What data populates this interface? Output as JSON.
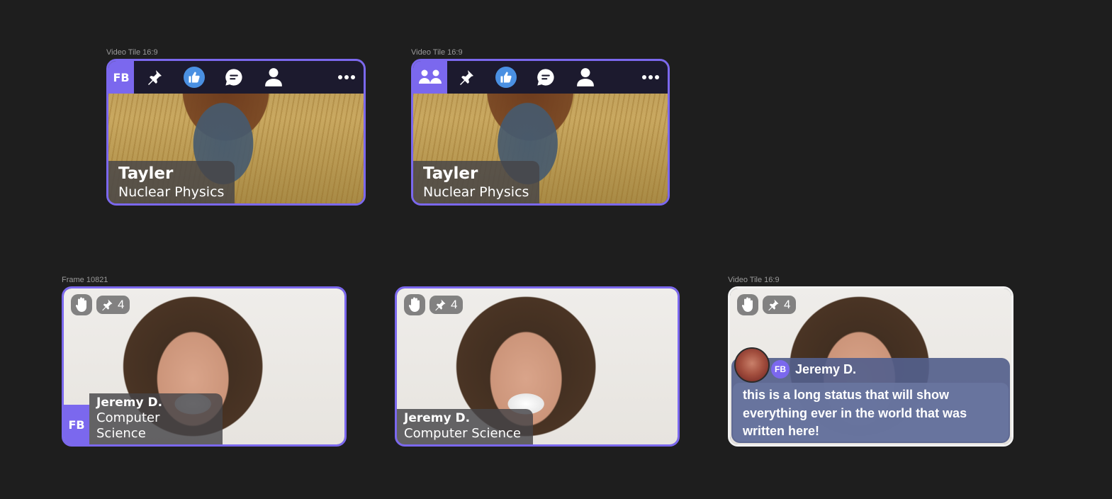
{
  "frames": {
    "top_left": "Video Tile 16:9",
    "top_right": "Video Tile 16:9",
    "bottom_left": "Frame 10821",
    "bottom_right": "Video Tile 16:9"
  },
  "toolbar_tiles": [
    {
      "badge_text": "FB",
      "icons": [
        "pin-icon",
        "thumbs-up-icon",
        "chat-icon",
        "person-icon",
        "more-icon"
      ],
      "participant": {
        "name": "Tayler",
        "subtitle": "Nuclear Physics"
      }
    },
    {
      "badge_icon": "group-icon",
      "icons": [
        "pin-icon",
        "thumbs-up-icon",
        "chat-icon",
        "person-icon",
        "more-icon"
      ],
      "participant": {
        "name": "Tayler",
        "subtitle": "Nuclear Physics"
      }
    }
  ],
  "video_tiles": [
    {
      "badge_text": "FB",
      "pin_count": "4",
      "participant": {
        "name": "Jeremy D.",
        "subtitle": "Computer Science"
      }
    },
    {
      "pin_count": "4",
      "participant": {
        "name": "Jeremy D.",
        "subtitle": "Computer Science"
      }
    },
    {
      "pin_count": "4",
      "status": {
        "badge_text": "FB",
        "name": "Jeremy D.",
        "message": "this is a long status that will show everything ever in the world that was written here!"
      }
    }
  ],
  "colors": {
    "background": "#1e1e1e",
    "accent": "#7b68ee",
    "toolbar": "#1c1a2e",
    "like_blue": "#4a90e2"
  }
}
